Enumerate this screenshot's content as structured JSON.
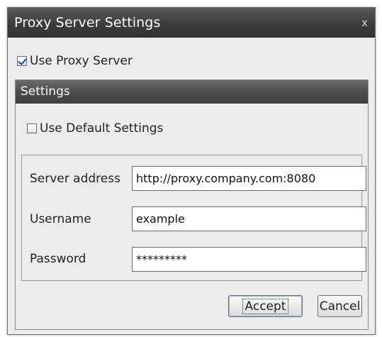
{
  "window": {
    "title": "Proxy Server Settings",
    "close_glyph": "x"
  },
  "use_proxy": {
    "label": "Use Proxy Server",
    "checked": true
  },
  "settings": {
    "header": "Settings",
    "use_default": {
      "label": "Use Default Settings",
      "checked": false
    },
    "fields": {
      "server_address": {
        "label": "Server address",
        "value": "http://proxy.company.com:8080"
      },
      "username": {
        "label": "Username",
        "value": "example"
      },
      "password": {
        "label": "Password",
        "value": "*********"
      }
    }
  },
  "buttons": {
    "accept": "Accept",
    "cancel": "Cancel"
  },
  "colors": {
    "titlebar": "#3c3c3c",
    "panel_header": "#4b4b4b",
    "dialog_bg": "#ececec",
    "check_mark": "#1b4a9e"
  },
  "icons": {
    "close": "close-icon",
    "check": "checkmark-icon"
  }
}
